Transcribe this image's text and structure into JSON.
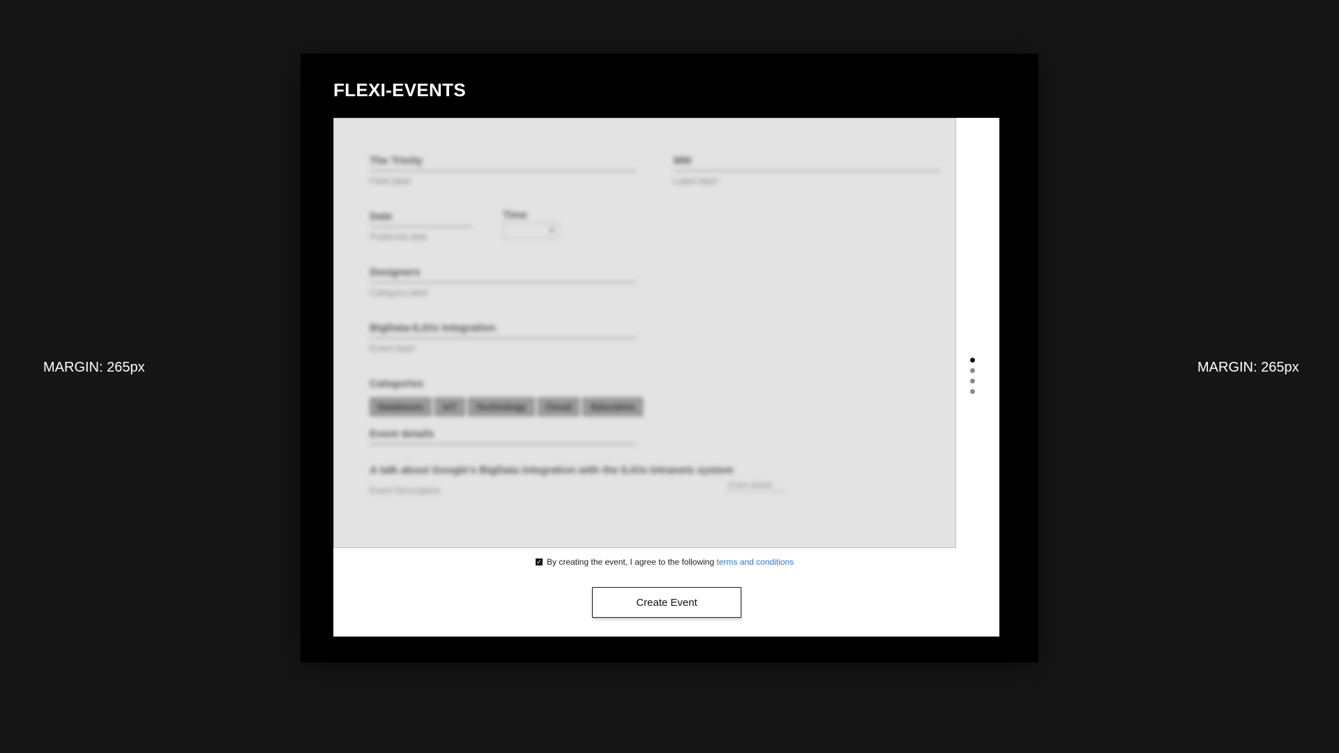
{
  "page": {
    "margin_left_label": "MARGIN: 265px",
    "margin_right_label": "MARGIN: 265px"
  },
  "app": {
    "title": "FLEXI-EVENTS"
  },
  "form": {
    "fields": {
      "title": {
        "label": "The Trinity",
        "hint": "Field label"
      },
      "venue": {
        "label": "MM",
        "hint": "Label label"
      },
      "date": {
        "label": "Date",
        "hint": "Preferred date"
      },
      "time": {
        "label": "Time",
        "value": "▾"
      },
      "designer": {
        "label": "Designers",
        "hint": "Category label"
      },
      "integration": {
        "label": "BigData-ILIOs Integration",
        "hint": "Event label"
      },
      "categories": {
        "label": "Categories",
        "chips": [
          "Databases",
          "IoT",
          "Technology",
          "Cloud",
          "Education"
        ]
      },
      "event_details": {
        "label": "Event details"
      },
      "description": {
        "label": "A talk about Google's BigData integration with the ILIOs Intranets system",
        "hint": "Event Description",
        "count": "Event details"
      }
    }
  },
  "pager": {
    "dots": 4,
    "active": 0
  },
  "terms": {
    "checked": true,
    "checkbox_glyph": "✓",
    "text": "By creating the event, I agree to the following ",
    "link_text": "terms and conditions"
  },
  "actions": {
    "create_label": "Create Event"
  }
}
